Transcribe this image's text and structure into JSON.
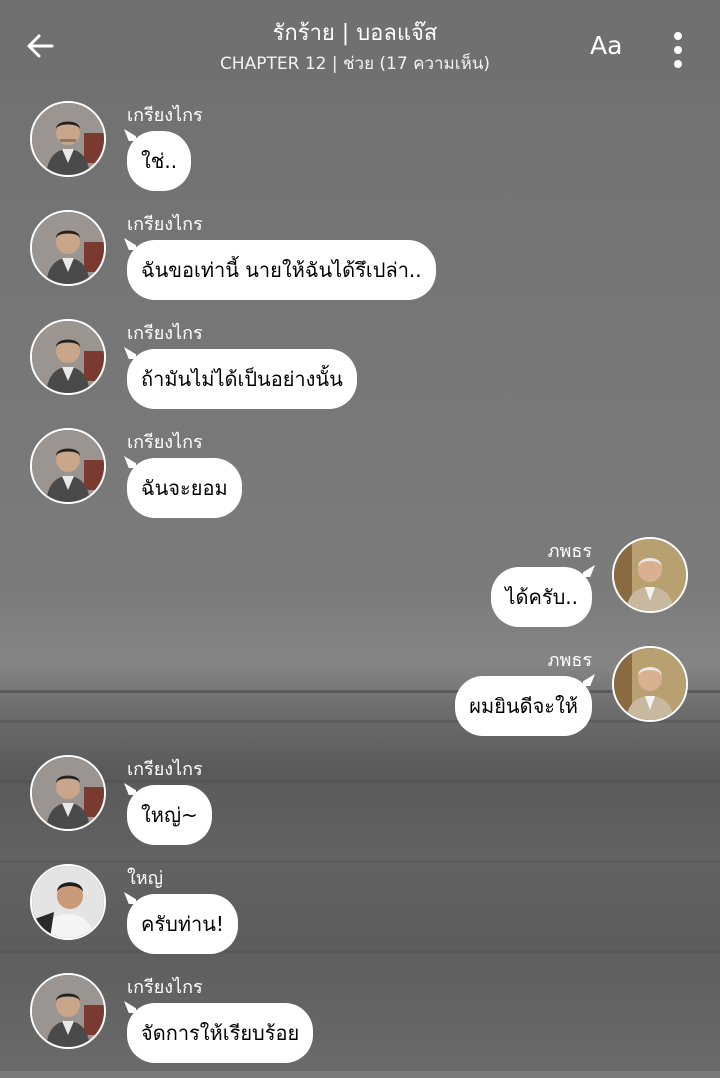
{
  "header": {
    "title": "รักร้าย | บอลแจ๊ส",
    "subtitle": "CHAPTER 12 | ช่วย (17 ความเห็น)",
    "font_button": "Aa",
    "back_icon": "arrow-left-icon",
    "more_icon": "more-vertical-icon"
  },
  "messages": [
    {
      "name": "เกรียงไกร",
      "text": "ใช่..",
      "side": "left"
    },
    {
      "name": "เกรียงไกร",
      "text": "ฉันขอเท่านี้ นายให้ฉันได้รึเปล่า..",
      "side": "left"
    },
    {
      "name": "เกรียงไกร",
      "text": "ถ้ามันไม่ได้เป็นอย่างนั้น",
      "side": "left"
    },
    {
      "name": "เกรียงไกร",
      "text": "ฉันจะยอม",
      "side": "left"
    },
    {
      "name": "ภพธร",
      "text": "ได้ครับ..",
      "side": "right"
    },
    {
      "name": "ภพธร",
      "text": "ผมยินดีจะให้",
      "side": "right"
    },
    {
      "name": "เกรียงไกร",
      "text": "ใหญ่~",
      "side": "left"
    },
    {
      "name": "ใหญ่",
      "text": "ครับท่าน!",
      "side": "left"
    },
    {
      "name": "เกรียงไกร",
      "text": "จัดการให้เรียบร้อย",
      "side": "left"
    }
  ]
}
